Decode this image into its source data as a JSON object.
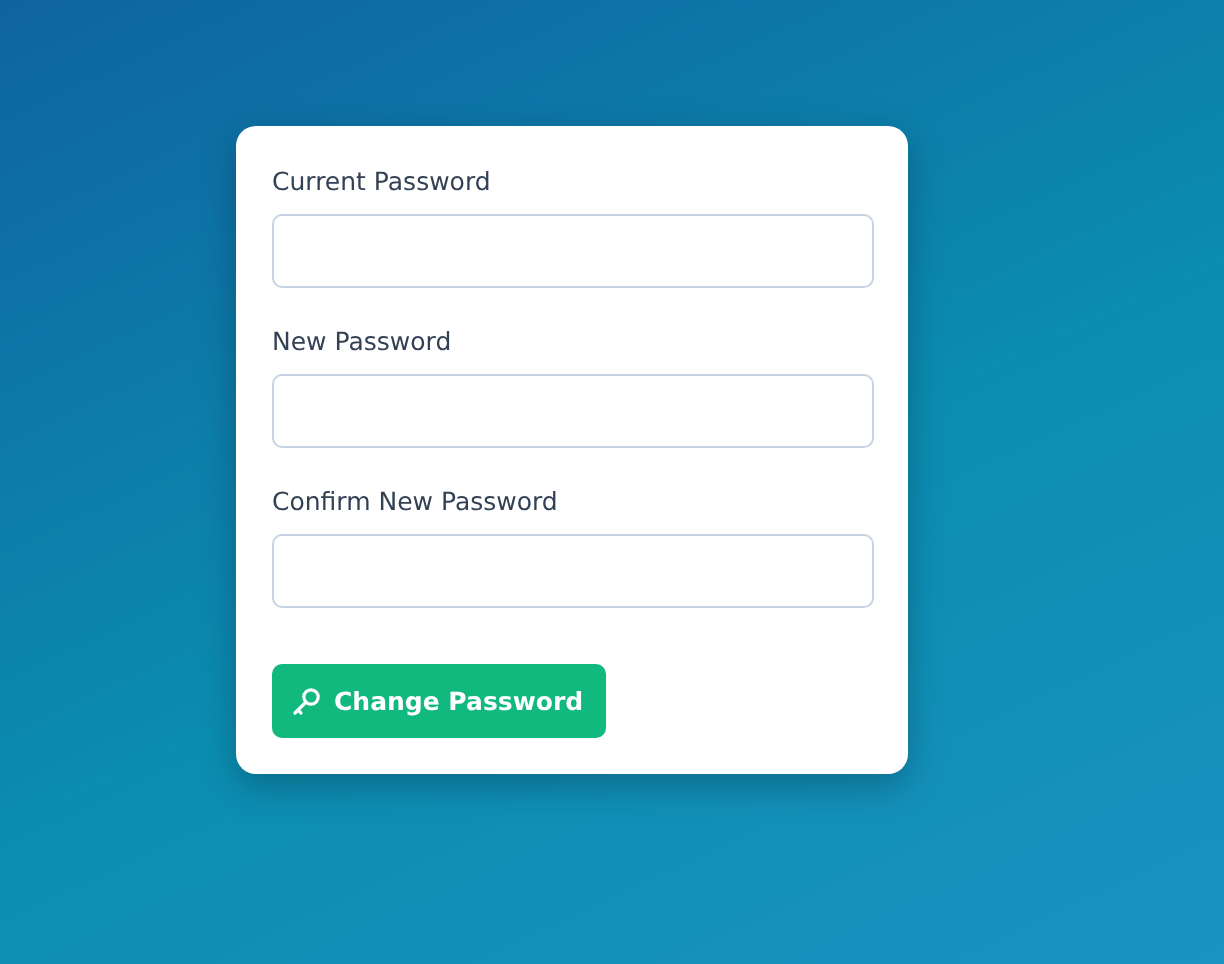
{
  "form": {
    "fields": [
      {
        "label": "Current Password"
      },
      {
        "label": "New Password"
      },
      {
        "label": "Confirm New Password"
      }
    ],
    "submit_button": {
      "label": "Change Password"
    }
  }
}
